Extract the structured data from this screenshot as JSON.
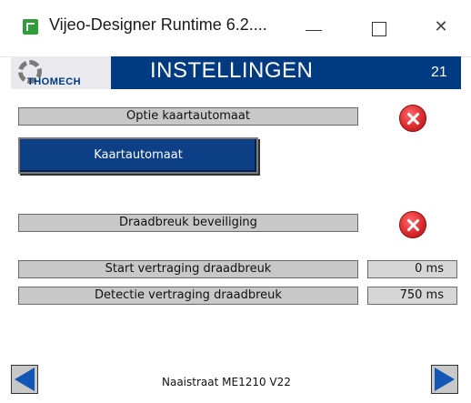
{
  "window": {
    "title": "Vijeo-Designer Runtime 6.2....",
    "icons": {
      "app": "app-icon",
      "minimize": "minimize-icon",
      "maximize": "maximize-icon",
      "close": "close-icon"
    },
    "close_glyph": "✕"
  },
  "header": {
    "logo_text": "THOMECH",
    "title": "INSTELLINGEN",
    "screen_number": "21",
    "color": "#003a80"
  },
  "settings": {
    "card_option_label": "Optie kaartautomaat",
    "card_button_label": "Kaartautomaat",
    "wire_break_label": "Draadbreuk beveiliging",
    "start_delay_label": "Start vertraging draadbreuk",
    "start_delay_value": "0 ms",
    "detect_delay_label": "Detectie vertraging draadbreuk",
    "detect_delay_value": "750 ms",
    "status_icon": "error-x-icon",
    "status_color": "#d9262a"
  },
  "footer": {
    "address": "Naaistraat ME1210 V22",
    "prev_icon": "arrow-left-icon",
    "next_icon": "arrow-right-icon",
    "arrow_color": "#1456b5"
  }
}
